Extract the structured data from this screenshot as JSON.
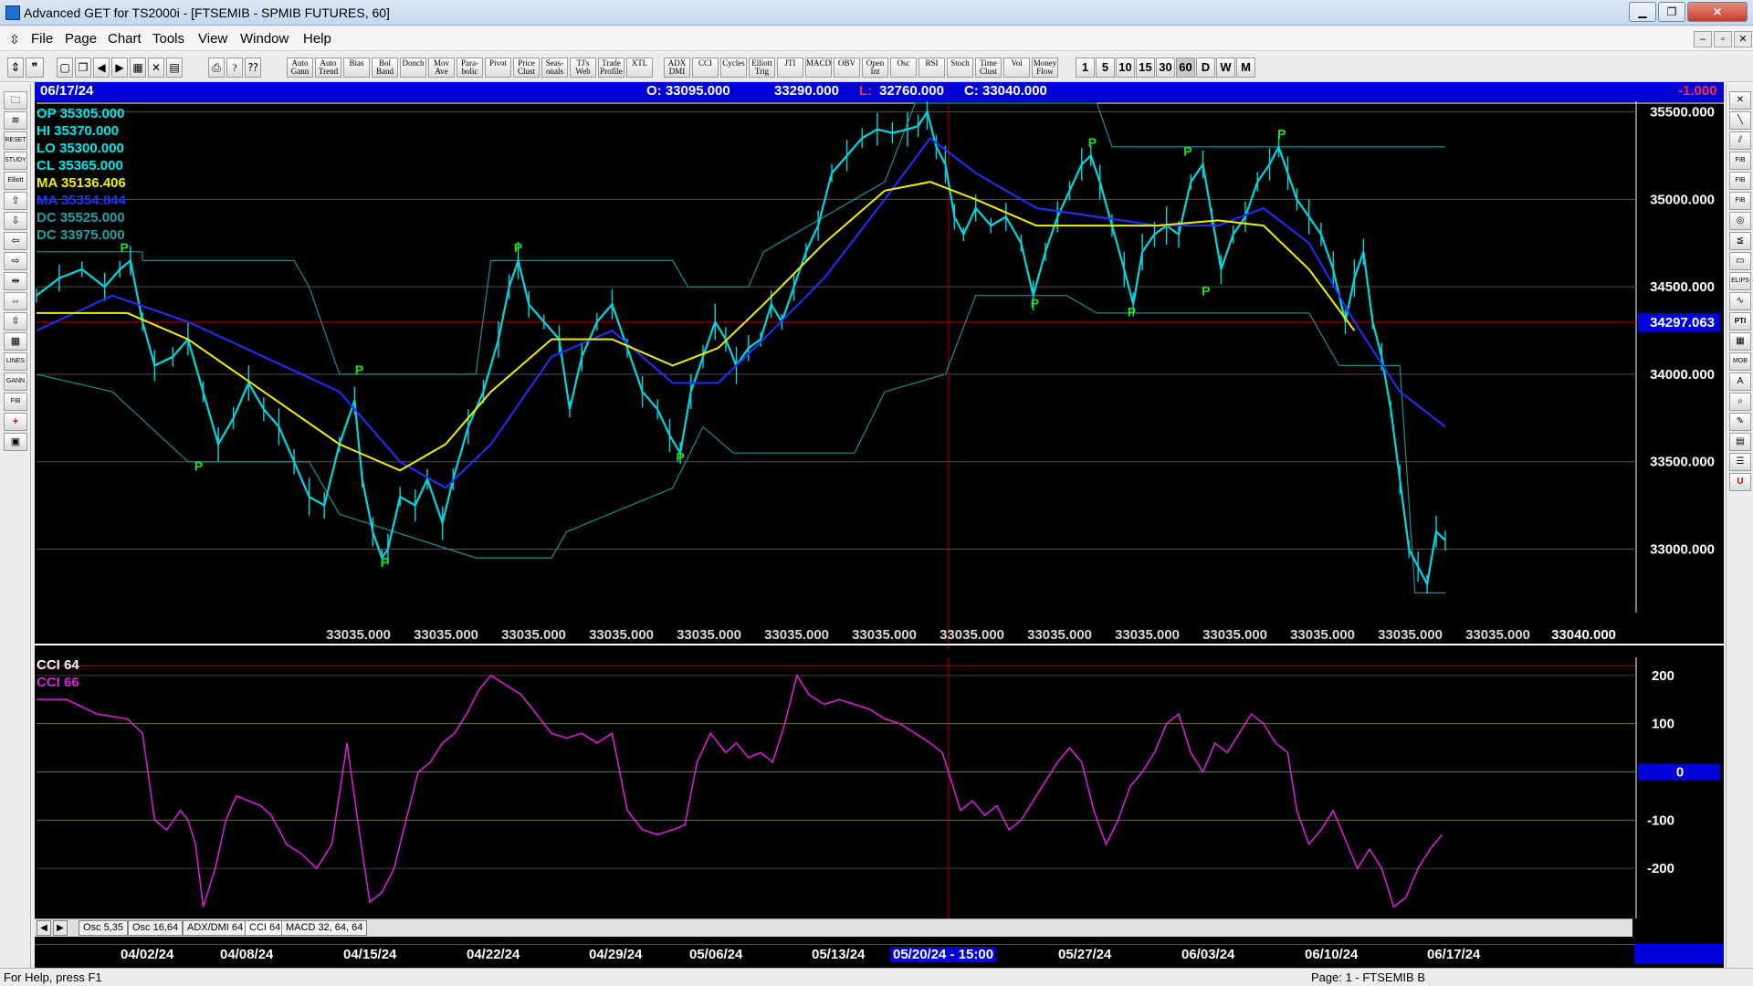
{
  "window": {
    "title": "Advanced GET for TS2000i - [FTSEMIB - SPMIB FUTURES, 60]"
  },
  "menu": [
    "File",
    "Page",
    "Chart",
    "Tools",
    "View",
    "Window",
    "Help"
  ],
  "toolbar": {
    "study_buttons": [
      "Auto Gann",
      "Auto Trend",
      "Bias",
      "Bol Band",
      "Donch",
      "Mov Ave",
      "Para-bolic",
      "Pivot",
      "Price Clust",
      "Seas-onals",
      "TJ's Web",
      "Trade Profile",
      "XTL",
      "ADX DMI",
      "CCI",
      "Cycles",
      "Elliott Trig",
      "JTI",
      "MACD",
      "OBV",
      "Open Int",
      "Osc",
      "RSI",
      "Stoch",
      "Time Clust",
      "Vol",
      "Money Flow"
    ],
    "intervals": [
      "1",
      "5",
      "10",
      "15",
      "30",
      "60",
      "D",
      "W",
      "M"
    ],
    "active_interval": "60"
  },
  "info_bar": {
    "date": "06/17/24",
    "open": "O: 33095.000",
    "high": "33290.000",
    "low_prefix": "L:",
    "low": "32760.000",
    "close": "C: 33040.000",
    "change": "-1.000"
  },
  "legend": {
    "op": "OP  35305.000",
    "hi": "HI   35370.000",
    "lo": "LO  35300.000",
    "cl": "CL  35365.000",
    "ma": "MA  35136.406",
    "ma2": "MA  35354.844",
    "dc1": "DC  35525.000",
    "dc2": "DC  33975.000"
  },
  "price_axis": {
    "labels": [
      "35500.000",
      "35000.000",
      "34500.000",
      "34000.000",
      "33500.000",
      "33000.000"
    ],
    "crosshair_price": "34297.063",
    "bottom_values": [
      "33035.000",
      "33035.000",
      "33035.000",
      "33035.000",
      "33035.000",
      "33035.000",
      "33035.000",
      "33035.000",
      "33035.000",
      "33035.000",
      "33035.000",
      "33035.000",
      "33035.000",
      "33035.000"
    ],
    "bottom_last": "33040.000"
  },
  "cci_panel": {
    "label1": "CCI 64",
    "label2": "CCI  66",
    "axis_labels": [
      "200",
      "100",
      "0",
      "-100",
      "-200"
    ]
  },
  "tabs": [
    "Osc 5,35",
    "Osc 16,64",
    "ADX/DMI 64",
    "CCI 64",
    "MACD 32, 64, 64"
  ],
  "active_tab": "CCI 64",
  "date_axis": {
    "labels": [
      "04/02/24",
      "04/08/24",
      "04/15/24",
      "04/22/24",
      "04/29/24",
      "05/06/24",
      "05/13/24",
      "05/27/24",
      "06/03/24",
      "06/10/24",
      "06/17/24"
    ],
    "cursor_date": "05/20/24 - 15:00"
  },
  "status": {
    "help": "For Help, press F1",
    "page": "Page: 1 - FTSEMIB B"
  },
  "chart_data": {
    "type": "line",
    "title": "FTSEMIB - SPMIB FUTURES, 60",
    "ylim": [
      32700,
      35550
    ],
    "y_ticks": [
      33000,
      33500,
      34000,
      34500,
      35000,
      35500
    ],
    "price_path": [
      [
        0,
        34450
      ],
      [
        15,
        34550
      ],
      [
        30,
        34600
      ],
      [
        45,
        34500
      ],
      [
        55,
        34600
      ],
      [
        62,
        34650
      ],
      [
        70,
        34300
      ],
      [
        78,
        34050
      ],
      [
        90,
        34100
      ],
      [
        100,
        34200
      ],
      [
        110,
        33900
      ],
      [
        120,
        33600
      ],
      [
        130,
        33750
      ],
      [
        140,
        33950
      ],
      [
        150,
        33800
      ],
      [
        160,
        33700
      ],
      [
        170,
        33500
      ],
      [
        180,
        33300
      ],
      [
        190,
        33250
      ],
      [
        200,
        33600
      ],
      [
        210,
        33850
      ],
      [
        215,
        33400
      ],
      [
        222,
        33100
      ],
      [
        228,
        32950
      ],
      [
        232,
        33000
      ],
      [
        240,
        33300
      ],
      [
        250,
        33250
      ],
      [
        258,
        33400
      ],
      [
        268,
        33150
      ],
      [
        275,
        33400
      ],
      [
        285,
        33700
      ],
      [
        295,
        33900
      ],
      [
        305,
        34200
      ],
      [
        312,
        34500
      ],
      [
        318,
        34650
      ],
      [
        325,
        34400
      ],
      [
        335,
        34300
      ],
      [
        345,
        34200
      ],
      [
        352,
        33800
      ],
      [
        360,
        34100
      ],
      [
        370,
        34300
      ],
      [
        380,
        34400
      ],
      [
        390,
        34150
      ],
      [
        400,
        33900
      ],
      [
        410,
        33800
      ],
      [
        418,
        33650
      ],
      [
        425,
        33550
      ],
      [
        432,
        33900
      ],
      [
        440,
        34100
      ],
      [
        448,
        34300
      ],
      [
        455,
        34200
      ],
      [
        462,
        34050
      ],
      [
        470,
        34150
      ],
      [
        478,
        34200
      ],
      [
        485,
        34400
      ],
      [
        492,
        34300
      ],
      [
        500,
        34500
      ],
      [
        508,
        34700
      ],
      [
        516,
        34850
      ],
      [
        525,
        35150
      ],
      [
        535,
        35250
      ],
      [
        545,
        35350
      ],
      [
        555,
        35400
      ],
      [
        565,
        35380
      ],
      [
        575,
        35400
      ],
      [
        582,
        35420
      ],
      [
        588,
        35500
      ],
      [
        594,
        35300
      ],
      [
        600,
        35200
      ],
      [
        606,
        34900
      ],
      [
        612,
        34800
      ],
      [
        620,
        34950
      ],
      [
        630,
        34850
      ],
      [
        640,
        34900
      ],
      [
        650,
        34750
      ],
      [
        658,
        34450
      ],
      [
        666,
        34700
      ],
      [
        674,
        34900
      ],
      [
        682,
        35050
      ],
      [
        690,
        35200
      ],
      [
        696,
        35250
      ],
      [
        702,
        35100
      ],
      [
        710,
        34850
      ],
      [
        718,
        34600
      ],
      [
        724,
        34400
      ],
      [
        730,
        34700
      ],
      [
        738,
        34800
      ],
      [
        746,
        34850
      ],
      [
        754,
        34800
      ],
      [
        762,
        35100
      ],
      [
        770,
        35200
      ],
      [
        776,
        34900
      ],
      [
        782,
        34600
      ],
      [
        790,
        34800
      ],
      [
        798,
        34900
      ],
      [
        806,
        35100
      ],
      [
        814,
        35200
      ],
      [
        820,
        35300
      ],
      [
        826,
        35150
      ],
      [
        832,
        35000
      ],
      [
        840,
        34900
      ],
      [
        848,
        34800
      ],
      [
        856,
        34600
      ],
      [
        864,
        34300
      ],
      [
        870,
        34550
      ],
      [
        876,
        34700
      ],
      [
        882,
        34300
      ],
      [
        888,
        34100
      ],
      [
        894,
        33800
      ],
      [
        900,
        33400
      ],
      [
        906,
        33000
      ],
      [
        912,
        32900
      ],
      [
        918,
        32800
      ],
      [
        924,
        33100
      ],
      [
        930,
        33050
      ]
    ],
    "ma_yellow": [
      [
        0,
        34350
      ],
      [
        60,
        34350
      ],
      [
        100,
        34200
      ],
      [
        150,
        33900
      ],
      [
        200,
        33600
      ],
      [
        240,
        33450
      ],
      [
        270,
        33600
      ],
      [
        300,
        33900
      ],
      [
        340,
        34200
      ],
      [
        380,
        34200
      ],
      [
        420,
        34050
      ],
      [
        450,
        34150
      ],
      [
        480,
        34400
      ],
      [
        520,
        34750
      ],
      [
        560,
        35050
      ],
      [
        590,
        35100
      ],
      [
        620,
        35000
      ],
      [
        660,
        34850
      ],
      [
        700,
        34850
      ],
      [
        740,
        34850
      ],
      [
        780,
        34880
      ],
      [
        810,
        34850
      ],
      [
        840,
        34600
      ],
      [
        870,
        34250
      ]
    ],
    "ma_blue": [
      [
        0,
        34250
      ],
      [
        50,
        34450
      ],
      [
        100,
        34300
      ],
      [
        150,
        34100
      ],
      [
        200,
        33900
      ],
      [
        240,
        33500
      ],
      [
        270,
        33350
      ],
      [
        300,
        33600
      ],
      [
        340,
        34100
      ],
      [
        380,
        34250
      ],
      [
        420,
        33950
      ],
      [
        450,
        33950
      ],
      [
        480,
        34200
      ],
      [
        520,
        34550
      ],
      [
        560,
        35000
      ],
      [
        590,
        35350
      ],
      [
        620,
        35150
      ],
      [
        660,
        34950
      ],
      [
        700,
        34900
      ],
      [
        740,
        34850
      ],
      [
        780,
        34850
      ],
      [
        810,
        34950
      ],
      [
        840,
        34750
      ],
      [
        870,
        34300
      ],
      [
        900,
        33900
      ],
      [
        930,
        33700
      ]
    ],
    "donchian_upper": [
      [
        0,
        34700
      ],
      [
        70,
        34700
      ],
      [
        70,
        34650
      ],
      [
        170,
        34650
      ],
      [
        180,
        34500
      ],
      [
        200,
        34000
      ],
      [
        290,
        34000
      ],
      [
        300,
        34650
      ],
      [
        420,
        34650
      ],
      [
        430,
        34500
      ],
      [
        470,
        34500
      ],
      [
        480,
        34700
      ],
      [
        560,
        35100
      ],
      [
        580,
        35550
      ],
      [
        700,
        35550
      ],
      [
        710,
        35300
      ],
      [
        760,
        35300
      ],
      [
        820,
        35300
      ],
      [
        930,
        35300
      ]
    ],
    "donchian_lower": [
      [
        0,
        34000
      ],
      [
        50,
        33900
      ],
      [
        100,
        33500
      ],
      [
        180,
        33500
      ],
      [
        200,
        33200
      ],
      [
        290,
        32950
      ],
      [
        340,
        32950
      ],
      [
        350,
        33100
      ],
      [
        420,
        33350
      ],
      [
        440,
        33700
      ],
      [
        460,
        33550
      ],
      [
        540,
        33550
      ],
      [
        560,
        33900
      ],
      [
        600,
        34000
      ],
      [
        620,
        34450
      ],
      [
        680,
        34450
      ],
      [
        700,
        34350
      ],
      [
        760,
        34350
      ],
      [
        840,
        34350
      ],
      [
        860,
        34050
      ],
      [
        900,
        34050
      ],
      [
        910,
        32750
      ],
      [
        930,
        32750
      ]
    ],
    "pivot_marks": [
      {
        "x": 58,
        "y": 34700,
        "label": "P"
      },
      {
        "x": 107,
        "y": 33450,
        "label": "P"
      },
      {
        "x": 213,
        "y": 34000,
        "label": "P"
      },
      {
        "x": 230,
        "y": 32900,
        "label": "P"
      },
      {
        "x": 318,
        "y": 34700,
        "label": "P"
      },
      {
        "x": 425,
        "y": 33500,
        "label": "P"
      },
      {
        "x": 659,
        "y": 34380,
        "label": "P"
      },
      {
        "x": 697,
        "y": 35300,
        "label": "P"
      },
      {
        "x": 723,
        "y": 34330,
        "label": "P"
      },
      {
        "x": 760,
        "y": 35250,
        "label": "P"
      },
      {
        "x": 772,
        "y": 34450,
        "label": "P"
      },
      {
        "x": 822,
        "y": 35350,
        "label": "P"
      }
    ],
    "cci_ylim": [
      -300,
      230
    ],
    "cci_levels": [
      100,
      -100,
      0
    ],
    "cci": [
      [
        0,
        150
      ],
      [
        20,
        150
      ],
      [
        40,
        120
      ],
      [
        60,
        110
      ],
      [
        70,
        80
      ],
      [
        78,
        -100
      ],
      [
        86,
        -120
      ],
      [
        95,
        -80
      ],
      [
        100,
        -100
      ],
      [
        105,
        -150
      ],
      [
        110,
        -280
      ],
      [
        118,
        -200
      ],
      [
        125,
        -100
      ],
      [
        132,
        -50
      ],
      [
        140,
        -60
      ],
      [
        148,
        -70
      ],
      [
        155,
        -90
      ],
      [
        165,
        -150
      ],
      [
        175,
        -170
      ],
      [
        185,
        -200
      ],
      [
        195,
        -150
      ],
      [
        205,
        60
      ],
      [
        212,
        -100
      ],
      [
        220,
        -270
      ],
      [
        228,
        -250
      ],
      [
        236,
        -200
      ],
      [
        244,
        -100
      ],
      [
        252,
        0
      ],
      [
        260,
        20
      ],
      [
        268,
        60
      ],
      [
        276,
        80
      ],
      [
        284,
        120
      ],
      [
        292,
        170
      ],
      [
        300,
        200
      ],
      [
        310,
        180
      ],
      [
        320,
        160
      ],
      [
        330,
        120
      ],
      [
        340,
        80
      ],
      [
        350,
        70
      ],
      [
        360,
        80
      ],
      [
        370,
        60
      ],
      [
        380,
        80
      ],
      [
        390,
        -80
      ],
      [
        400,
        -120
      ],
      [
        410,
        -130
      ],
      [
        420,
        -120
      ],
      [
        428,
        -110
      ],
      [
        436,
        20
      ],
      [
        445,
        80
      ],
      [
        455,
        40
      ],
      [
        462,
        60
      ],
      [
        470,
        30
      ],
      [
        478,
        40
      ],
      [
        486,
        20
      ],
      [
        494,
        100
      ],
      [
        502,
        200
      ],
      [
        510,
        160
      ],
      [
        520,
        140
      ],
      [
        530,
        150
      ],
      [
        540,
        140
      ],
      [
        550,
        130
      ],
      [
        560,
        110
      ],
      [
        570,
        100
      ],
      [
        580,
        80
      ],
      [
        590,
        60
      ],
      [
        598,
        40
      ],
      [
        604,
        -20
      ],
      [
        610,
        -80
      ],
      [
        618,
        -60
      ],
      [
        626,
        -90
      ],
      [
        634,
        -70
      ],
      [
        642,
        -120
      ],
      [
        650,
        -100
      ],
      [
        658,
        -60
      ],
      [
        666,
        -20
      ],
      [
        674,
        20
      ],
      [
        682,
        50
      ],
      [
        690,
        20
      ],
      [
        698,
        -80
      ],
      [
        706,
        -150
      ],
      [
        714,
        -100
      ],
      [
        722,
        -30
      ],
      [
        730,
        0
      ],
      [
        738,
        40
      ],
      [
        746,
        100
      ],
      [
        754,
        120
      ],
      [
        762,
        40
      ],
      [
        770,
        0
      ],
      [
        778,
        60
      ],
      [
        786,
        40
      ],
      [
        794,
        80
      ],
      [
        802,
        120
      ],
      [
        810,
        100
      ],
      [
        818,
        60
      ],
      [
        826,
        40
      ],
      [
        832,
        -80
      ],
      [
        840,
        -150
      ],
      [
        848,
        -120
      ],
      [
        856,
        -80
      ],
      [
        864,
        -140
      ],
      [
        872,
        -200
      ],
      [
        880,
        -160
      ],
      [
        888,
        -200
      ],
      [
        896,
        -280
      ],
      [
        904,
        -260
      ],
      [
        912,
        -200
      ],
      [
        920,
        -160
      ],
      [
        928,
        -130
      ]
    ]
  }
}
